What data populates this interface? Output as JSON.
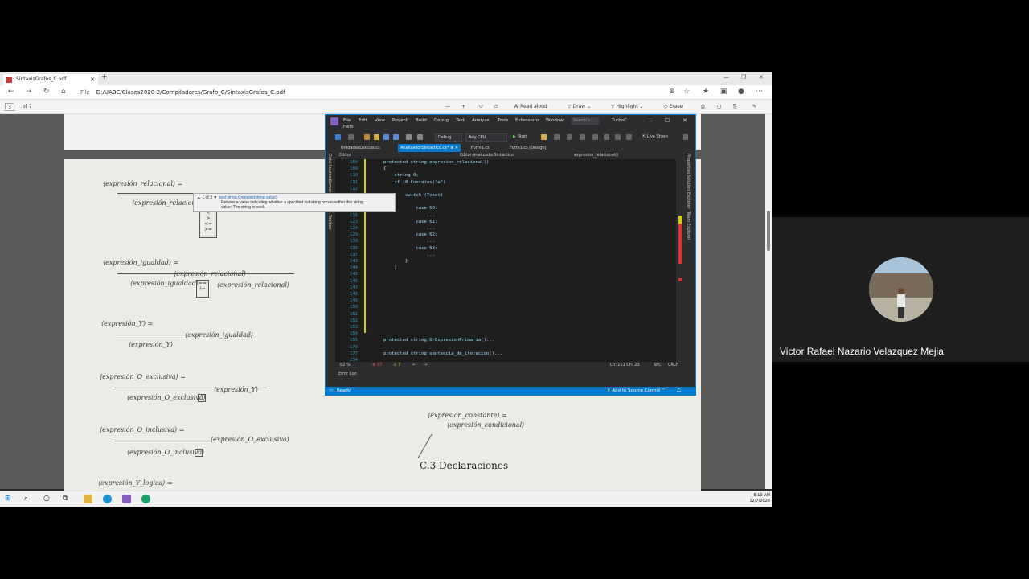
{
  "browser": {
    "tab_title": "SintaxisGrafos_C.pdf",
    "new_tab": "+",
    "file_label": "File",
    "url": "D:/UABC/Clases2020-2/Compiladores/Grafo_C/SintaxisGrafos_C.pdf"
  },
  "pdf_toolbar": {
    "page_number": "3",
    "page_total": "of 7",
    "read_aloud": "Read aloud",
    "draw": "Draw",
    "highlight": "Highlight",
    "erase": "Erase"
  },
  "pdf_page": {
    "labels": [
      "⟨expresión_relacional⟩ =",
      "⟨expresión_relacional⟩",
      "⟨expresión_igualdad⟩ =",
      "⟨expresión_relacional⟩",
      "⟨expresión_igualdad⟩",
      "⟨expresión_relacional⟩",
      "⟨expresión_Y⟩ =",
      "⟨expresión_igualdad⟩",
      "⟨expresión_Y⟩",
      "⟨expresión_O_exclusiva⟩ =",
      "⟨expresión_Y⟩",
      "⟨expresión_O_exclusiva⟩",
      "⟨expresión_O_inclusiva⟩ =",
      "⟨expresión_O_exclusiva⟩",
      "⟨expresión_O_inclusiva⟩",
      "⟨expresión_Y_logica⟩ =",
      "⟨expresión_constante⟩ =",
      "⟨expresión_condicional⟩"
    ],
    "heading": "C.3  Declaraciones"
  },
  "vs": {
    "menu": [
      "File",
      "Edit",
      "View",
      "Project",
      "Build",
      "Debug",
      "Test",
      "Analyze",
      "Tools",
      "Extensions",
      "Window",
      "Help"
    ],
    "search_placeholder": "Search",
    "solution_name": "TurboC",
    "config": "Debug",
    "platform": "Any CPU",
    "start_label": "Start",
    "live_share": "Live Share",
    "tabs": [
      "UnidadesLexicas.cs",
      "AnalizadorSintactico.cs*",
      "Form1.cs",
      "Form1.cs [Design]"
    ],
    "left_side": [
      "Data Sources",
      "Server Explorer",
      "Toolbox"
    ],
    "right_side": [
      "Properties",
      "Solution Explorer",
      "Team Explorer"
    ],
    "editor_project": "Editor",
    "editor_class": "Editor.AnalizadorSintactico",
    "editor_member": "expresion_relacional()",
    "code_lines": [
      {
        "n": "108",
        "t": "protected string expresion_relacional()"
      },
      {
        "n": "109",
        "t": "{"
      },
      {
        "n": "110",
        "t": "    string 0;"
      },
      {
        "n": "111",
        "t": "    if (0.Contains(\"e\")"
      },
      {
        "n": "112",
        "t": ""
      },
      {
        "n": "113",
        "t": "        switch (Token)"
      },
      {
        "n": "114",
        "t": ""
      },
      {
        "n": "115",
        "t": "            case 60:"
      },
      {
        "n": "116",
        "t": "                ..."
      },
      {
        "n": "123",
        "t": "            case 61:"
      },
      {
        "n": "124",
        "t": "                ..."
      },
      {
        "n": "129",
        "t": "            case 62:"
      },
      {
        "n": "130",
        "t": "                ..."
      },
      {
        "n": "136",
        "t": "            case 63:"
      },
      {
        "n": "137",
        "t": "                ..."
      },
      {
        "n": "143",
        "t": "        }"
      },
      {
        "n": "144",
        "t": "    }"
      },
      {
        "n": "145",
        "t": ""
      },
      {
        "n": "146",
        "t": ""
      },
      {
        "n": "147",
        "t": ""
      },
      {
        "n": "148",
        "t": ""
      },
      {
        "n": "149",
        "t": ""
      },
      {
        "n": "150",
        "t": ""
      },
      {
        "n": "151",
        "t": ""
      },
      {
        "n": "152",
        "t": ""
      },
      {
        "n": "153",
        "t": ""
      },
      {
        "n": "154",
        "t": ""
      },
      {
        "n": "155",
        "t": "protected string OrExpresionPrimaria()..."
      },
      {
        "n": "176",
        "t": ""
      },
      {
        "n": "177",
        "t": "protected string sentencia_de_iteracion()..."
      },
      {
        "n": "254",
        "t": ""
      }
    ],
    "tooltip": {
      "counter": "▲ 1 of 3 ▼",
      "signature": "bool string.Contains(string value)",
      "description": "Returns a value indicating whether a specified substring occurs within this string.",
      "param": "value: The string to seek."
    },
    "zoom": "82 %",
    "errors": "37",
    "warnings": "7",
    "position": "Ln: 111   Ch: 23",
    "spc": "SPC",
    "crlf": "CRLF",
    "error_list": "Error List",
    "status": "Ready",
    "source_control": "Add to Source Control"
  },
  "taskbar": {
    "time": "8:19 AM",
    "date": "12/7/2020"
  },
  "participant": {
    "name": "Victor Rafael Nazario Velazquez Mejia"
  }
}
